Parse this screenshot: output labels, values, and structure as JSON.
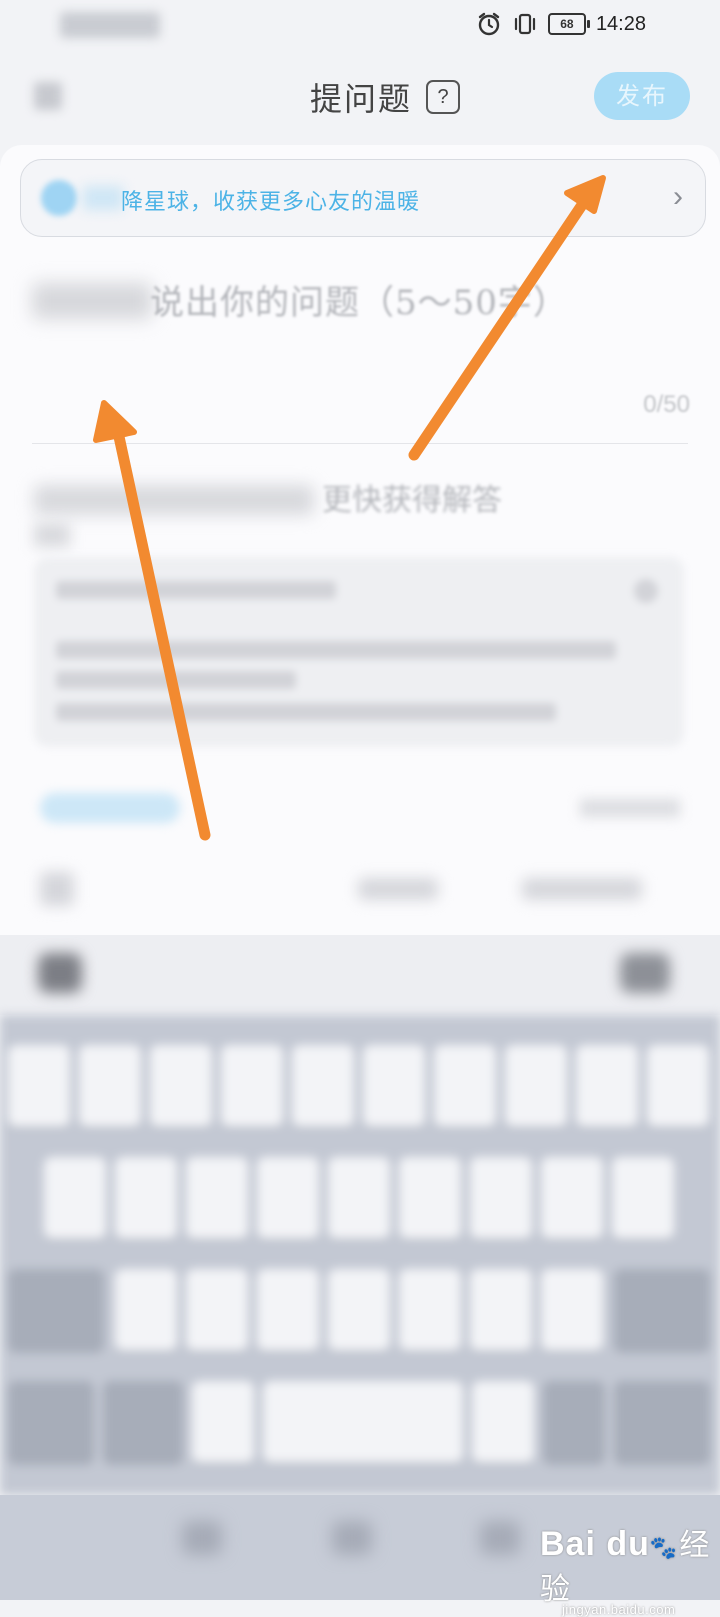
{
  "status_bar": {
    "battery": "68",
    "time": "14:28",
    "icons": [
      "alarm-icon",
      "vibrate-icon",
      "battery-icon"
    ]
  },
  "header": {
    "title": "提问题",
    "help_symbol": "?",
    "publish_label": "发布"
  },
  "banner": {
    "text": "降星球，收获更多心友的温暖",
    "chevron": "›"
  },
  "editor": {
    "placeholder": "说出你的问题（5～50字）",
    "char_count": "0/50"
  },
  "hint": {
    "text": "更快获得解答"
  },
  "colors": {
    "accent": "#4cb3e6",
    "publish_button": "#a9dcf6",
    "arrow": "#f28a30"
  },
  "watermark": {
    "logo": "Bai du",
    "paw": "🐾",
    "chinese": "经验",
    "url": "jingyan.baidu.com"
  }
}
